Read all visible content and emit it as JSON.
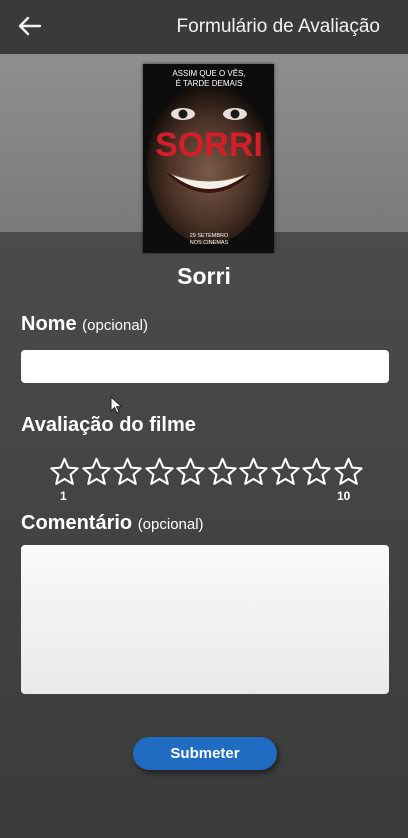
{
  "header": {
    "title": "Formulário de Avaliação",
    "back_icon": "arrow-left-icon"
  },
  "poster": {
    "tagline_line1": "ASSIM QUE O VÊS,",
    "tagline_line2": "É TARDE DEMAIS",
    "logo": "SORRI",
    "date_line1": "29 SETEMBRO",
    "date_line2": "NOS CINEMAS"
  },
  "movie": {
    "title": "Sorri"
  },
  "form": {
    "name_label": "Nome",
    "name_optional": "(opcional)",
    "name_value": "",
    "rating_label": "Avaliação do filme",
    "rating_min_label": "1",
    "rating_max_label": "10",
    "rating_value": 0,
    "rating_max": 10,
    "comment_label": "Comentário",
    "comment_optional": "(opcional)",
    "comment_value": "",
    "submit_label": "Submeter"
  },
  "colors": {
    "accent": "#1f6cc2",
    "background": "#3f3f3f",
    "header": "#3a3a3a"
  }
}
